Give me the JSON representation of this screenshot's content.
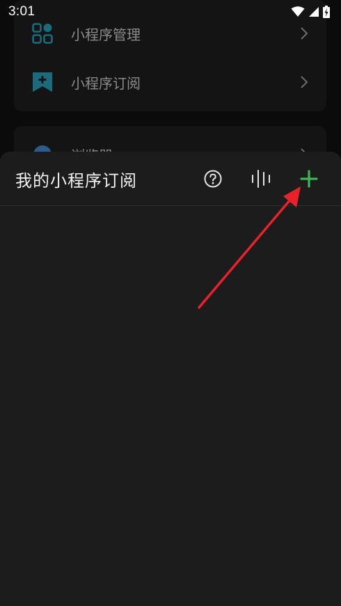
{
  "status_bar": {
    "time": "3:01"
  },
  "background_menu": {
    "items": [
      {
        "label": "小程序管理",
        "icon": "grid-apps-icon"
      },
      {
        "label": "小程序订阅",
        "icon": "subscription-bookmark-icon"
      },
      {
        "label": "浏览器",
        "icon": "browser-icon"
      }
    ]
  },
  "sheet": {
    "title": "我的小程序订阅",
    "actions": [
      {
        "icon": "help-icon"
      },
      {
        "icon": "voice-icon"
      },
      {
        "icon": "add-icon"
      }
    ]
  },
  "colors": {
    "accent_green": "#3fb658",
    "icon_teal": "#1a6b7c",
    "annotation_red": "#e8212b",
    "sheet_bg": "#1c1c1c"
  }
}
